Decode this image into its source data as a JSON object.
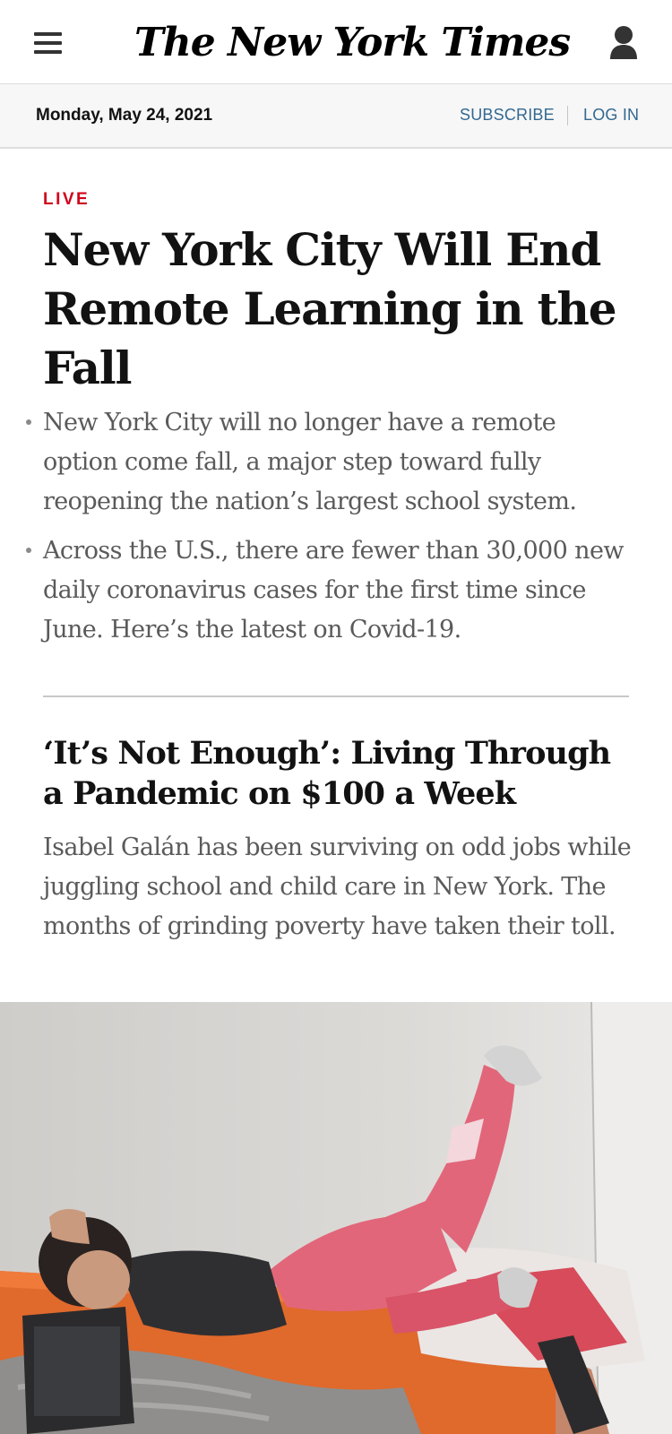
{
  "header": {
    "logo_text": "The New York Times",
    "menu_icon": "hamburger-menu-icon",
    "account_icon": "user-account-icon"
  },
  "datebar": {
    "date": "Monday, May 24, 2021",
    "subscribe_label": "SUBSCRIBE",
    "login_label": "LOG IN"
  },
  "lead_story": {
    "label": "LIVE",
    "headline": "New York City Will End Remote Learning in the Fall",
    "summary": [
      "New York City will no longer have a remote option come fall, a major step toward fully reopening the nation’s largest school system.",
      "Across the U.S., there are fewer than 30,000 new daily coronavirus cases for the first time since June. Here’s the latest on Covid-19."
    ]
  },
  "second_story": {
    "headline": "‘It’s Not Enough’: Living Through a Pandemic on $100 a Week",
    "summary": "Isabel Galán has been surviving on odd jobs while juggling school and child care in New York. The months of grinding poverty have taken their toll."
  },
  "colors": {
    "live_red": "#d0021b",
    "link_blue": "#326891",
    "headline_black": "#121212",
    "summary_gray": "#5a5a5a",
    "datebar_bg": "#f7f7f7"
  }
}
